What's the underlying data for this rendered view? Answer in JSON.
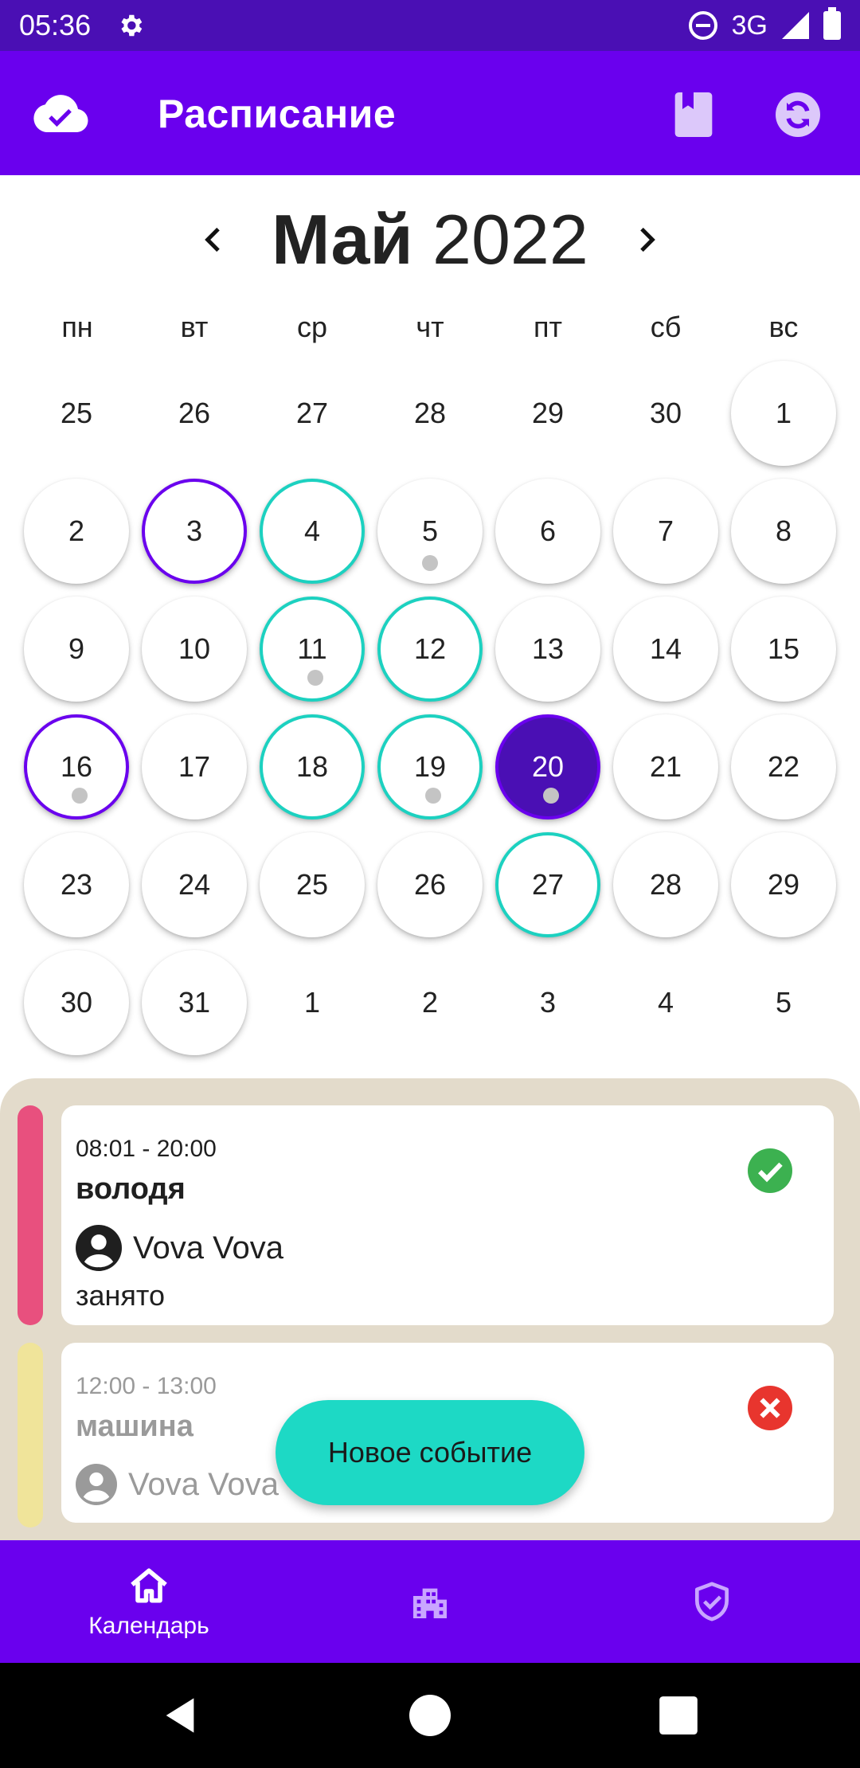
{
  "status_bar": {
    "time": "05:36",
    "network": "3G",
    "icons": [
      "gear-icon",
      "dnd-icon",
      "signal-icon",
      "battery-icon"
    ]
  },
  "app_bar": {
    "title": "Расписание",
    "icons": [
      "cloud-check-icon",
      "book-icon",
      "sync-icon"
    ]
  },
  "calendar": {
    "month": "Май",
    "year": "2022",
    "weekdays": [
      "пн",
      "вт",
      "ср",
      "чт",
      "пт",
      "сб",
      "вс"
    ],
    "weeks": [
      [
        {
          "d": "25",
          "bubble": false
        },
        {
          "d": "26",
          "bubble": false
        },
        {
          "d": "27",
          "bubble": false
        },
        {
          "d": "28",
          "bubble": false
        },
        {
          "d": "29",
          "bubble": false
        },
        {
          "d": "30",
          "bubble": false
        },
        {
          "d": "1",
          "bubble": true
        }
      ],
      [
        {
          "d": "2",
          "bubble": true
        },
        {
          "d": "3",
          "bubble": true,
          "ring": "purple"
        },
        {
          "d": "4",
          "bubble": true,
          "ring": "teal"
        },
        {
          "d": "5",
          "bubble": true,
          "dot": true
        },
        {
          "d": "6",
          "bubble": true
        },
        {
          "d": "7",
          "bubble": true
        },
        {
          "d": "8",
          "bubble": true
        }
      ],
      [
        {
          "d": "9",
          "bubble": true
        },
        {
          "d": "10",
          "bubble": true
        },
        {
          "d": "11",
          "bubble": true,
          "ring": "teal",
          "dot": true
        },
        {
          "d": "12",
          "bubble": true,
          "ring": "teal"
        },
        {
          "d": "13",
          "bubble": true
        },
        {
          "d": "14",
          "bubble": true
        },
        {
          "d": "15",
          "bubble": true
        }
      ],
      [
        {
          "d": "16",
          "bubble": true,
          "ring": "purple",
          "dot": true
        },
        {
          "d": "17",
          "bubble": true
        },
        {
          "d": "18",
          "bubble": true,
          "ring": "teal"
        },
        {
          "d": "19",
          "bubble": true,
          "ring": "teal",
          "dot": true
        },
        {
          "d": "20",
          "bubble": true,
          "selected": true,
          "dot": true
        },
        {
          "d": "21",
          "bubble": true
        },
        {
          "d": "22",
          "bubble": true
        }
      ],
      [
        {
          "d": "23",
          "bubble": true
        },
        {
          "d": "24",
          "bubble": true
        },
        {
          "d": "25",
          "bubble": true
        },
        {
          "d": "26",
          "bubble": true
        },
        {
          "d": "27",
          "bubble": true,
          "ring": "teal"
        },
        {
          "d": "28",
          "bubble": true
        },
        {
          "d": "29",
          "bubble": true
        }
      ],
      [
        {
          "d": "30",
          "bubble": true
        },
        {
          "d": "31",
          "bubble": true
        },
        {
          "d": "1",
          "bubble": false
        },
        {
          "d": "2",
          "bubble": false
        },
        {
          "d": "3",
          "bubble": false
        },
        {
          "d": "4",
          "bubble": false
        },
        {
          "d": "5",
          "bubble": false
        }
      ]
    ]
  },
  "events": [
    {
      "time": "08:01 - 20:00",
      "title": "володя",
      "person": "Vova Vova",
      "note": "занято",
      "status": "accepted",
      "stripe_color": "#e8507e"
    },
    {
      "time": "12:00 - 13:00",
      "title": "машина",
      "person": "Vova Vova",
      "note": "",
      "status": "declined",
      "stripe_color": "#f0e49a"
    }
  ],
  "fab": {
    "label": "Новое событие"
  },
  "bottom_nav": {
    "items": [
      {
        "label": "Календарь",
        "icon": "home-icon"
      },
      {
        "label": "",
        "icon": "buildings-icon"
      },
      {
        "label": "",
        "icon": "shield-check-icon"
      }
    ]
  },
  "colors": {
    "primary": "#6a00ee",
    "primary_dark": "#4a0fb4",
    "accent_teal": "#1cd1c0",
    "panel_bg": "#e3dbcb",
    "accepted": "#3cb150",
    "declined": "#e8352e"
  }
}
